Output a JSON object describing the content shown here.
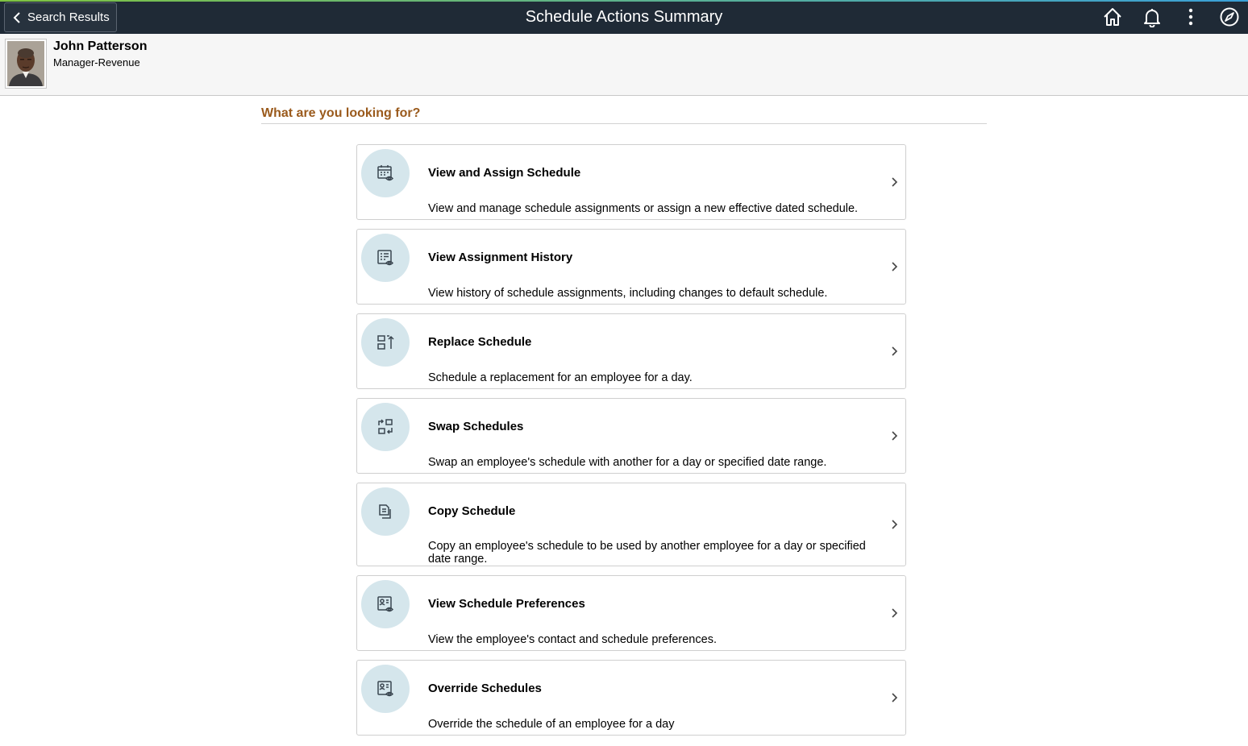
{
  "header": {
    "back_label": "Search Results",
    "title": "Schedule Actions Summary",
    "icons": [
      "home-icon",
      "bell-icon",
      "more-vertical-icon",
      "compass-icon"
    ]
  },
  "profile": {
    "name": "John Patterson",
    "job_title": "Manager-Revenue"
  },
  "section": {
    "title": "What are you looking for?"
  },
  "tiles": [
    {
      "title": "View and Assign Schedule",
      "description": "View and manage schedule assignments or assign a new effective dated schedule.",
      "icon": "calendar-view-icon"
    },
    {
      "title": "View Assignment History",
      "description": "View history of schedule assignments, including changes to default schedule.",
      "icon": "list-view-icon"
    },
    {
      "title": "Replace Schedule",
      "description": "Schedule a replacement for an employee for a day.",
      "icon": "replace-icon"
    },
    {
      "title": "Swap Schedules",
      "description": "Swap an employee's schedule with another for a day or specified date range.",
      "icon": "swap-icon"
    },
    {
      "title": "Copy Schedule",
      "description": "Copy an employee's schedule to be used by another employee for a day or specified date range.",
      "icon": "copy-icon"
    },
    {
      "title": "View Schedule Preferences",
      "description": "View the employee's contact and schedule preferences.",
      "icon": "contact-view-icon"
    },
    {
      "title": "Override Schedules",
      "description": "Override the schedule of an employee for a day",
      "icon": "contact-view-icon"
    }
  ],
  "colors": {
    "header_bg": "#1f2a36",
    "section_title": "#9a5a1c",
    "icon_circle": "#d5e6ec"
  }
}
